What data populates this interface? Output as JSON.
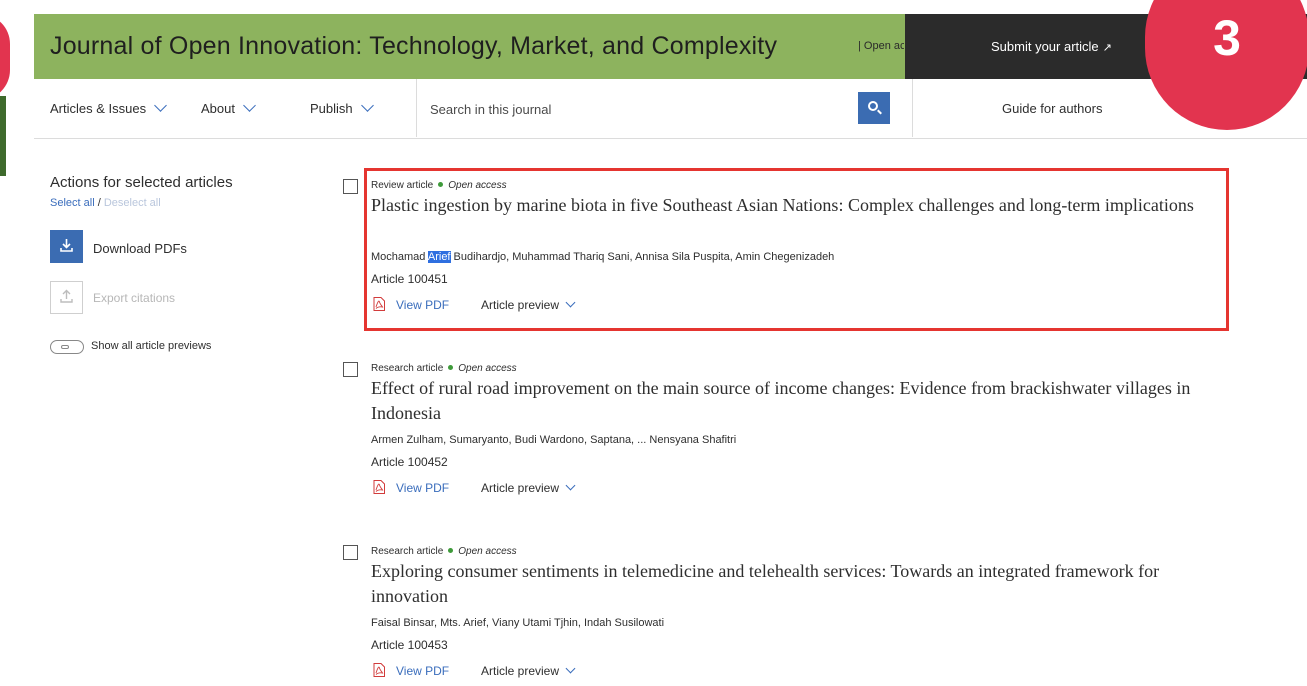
{
  "header": {
    "journal_title": "Journal of Open Innovation: Technology, Market, and Complexity",
    "open_access_tag": "| Open access",
    "submit_label": "Submit your article",
    "submit_icon": "external-arrow-icon"
  },
  "step_badge": "3",
  "nav": {
    "items": [
      {
        "label": "Articles & Issues"
      },
      {
        "label": "About"
      },
      {
        "label": "Publish"
      }
    ],
    "search_placeholder": "Search in this journal",
    "guide_label": "Guide for authors"
  },
  "sidebar": {
    "title": "Actions for selected articles",
    "select_all": "Select all",
    "slash": "/",
    "deselect_all": "Deselect all",
    "download_label": "Download PDFs",
    "export_label": "Export citations",
    "toggle_label": "Show all article previews"
  },
  "articles": [
    {
      "type": "Review article",
      "access": "Open access",
      "title": "Plastic ingestion by marine biota in five Southeast Asian Nations: Complex challenges and long-term implications",
      "author_first": "Mochamad ",
      "author_highlight": "Arief",
      "authors_rest": " Budihardjo, Muhammad Thariq Sani, Annisa Sila Puspita, Amin Chegenizadeh",
      "article_number": "Article 100451",
      "view_pdf": "View PDF",
      "preview": "Article preview",
      "highlighted": true
    },
    {
      "type": "Research article",
      "access": "Open access",
      "title": "Effect of rural road improvement on the main source of income changes: Evidence from brackishwater villages in Indonesia",
      "authors": "Armen Zulham, Sumaryanto, Budi Wardono, Saptana, ... Nensyana Shafitri",
      "article_number": "Article 100452",
      "view_pdf": "View PDF",
      "preview": "Article preview"
    },
    {
      "type": "Research article",
      "access": "Open access",
      "title": "Exploring consumer sentiments in telemedicine and telehealth services: Towards an integrated framework for innovation",
      "authors": "Faisal Binsar, Mts. Arief, Viany Utami Tjhin, Indah Susilowati",
      "article_number": "Article 100453",
      "view_pdf": "View PDF",
      "preview": "Article preview"
    }
  ],
  "colors": {
    "banner": "#8db35e",
    "submit_bg": "#2b2b2b",
    "badge": "#e2344f",
    "link_blue": "#3a6dbc",
    "highlight_box": "#e53530",
    "open_access_dot": "#3e9a3a"
  }
}
